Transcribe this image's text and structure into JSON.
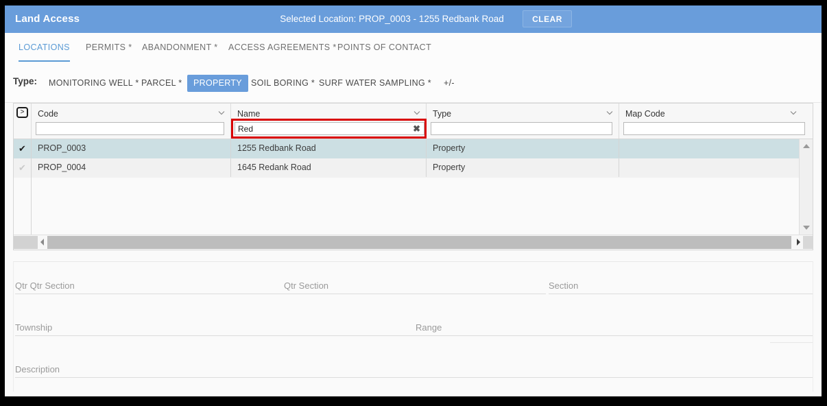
{
  "app": {
    "title": "Land Access",
    "selected_location": "Selected Location: PROP_0003 - 1255 Redbank Road",
    "clear_label": "CLEAR",
    "accent_color": "#699ddb",
    "active_tab_color": "#5b9bd5",
    "error_outline_color": "#d90000",
    "selected_row_color": "#ccdfe3"
  },
  "tabs": [
    {
      "label": "LOCATIONS",
      "active": true
    },
    {
      "label": "PERMITS *",
      "active": false
    },
    {
      "label": "ABANDONMENT *",
      "active": false
    },
    {
      "label": "ACCESS AGREEMENTS *",
      "active": false
    },
    {
      "label": "POINTS OF CONTACT",
      "active": false
    }
  ],
  "type_filter": {
    "label": "Type:",
    "options": [
      {
        "label": "MONITORING WELL *",
        "selected": false
      },
      {
        "label": "PARCEL *",
        "selected": false
      },
      {
        "label": "PROPERTY",
        "selected": true
      },
      {
        "label": "SOIL BORING *",
        "selected": false
      },
      {
        "label": "SURF WATER SAMPLING *",
        "selected": false
      },
      {
        "label": "+/-",
        "selected": false
      }
    ]
  },
  "grid": {
    "expand_toggle_glyph": ">",
    "columns": [
      {
        "title": "Code",
        "filter_value": "",
        "filter_placeholder": "",
        "caret": "chevron-down-icon"
      },
      {
        "title": "Name",
        "filter_value": "Red",
        "filter_placeholder": "",
        "caret": "chevron-down-icon",
        "highlighted": true,
        "clear_glyph": "✖"
      },
      {
        "title": "Type",
        "filter_value": "",
        "filter_placeholder": "",
        "caret": "chevron-down-icon"
      },
      {
        "title": "Map Code",
        "filter_value": "",
        "filter_placeholder": "",
        "caret": "chevron-down-icon"
      }
    ],
    "rows": [
      {
        "checked": true,
        "check_glyph": "✔",
        "code": "PROP_0003",
        "name": "1255 Redbank Road",
        "type": "Property",
        "map_code": ""
      },
      {
        "checked": false,
        "check_glyph": "✔",
        "code": "PROP_0004",
        "name": "1645 Redank Road",
        "type": "Property",
        "map_code": ""
      }
    ]
  },
  "form": {
    "fields": [
      {
        "label": "Qtr Qtr Section",
        "value": ""
      },
      {
        "label": "Qtr Section",
        "value": ""
      },
      {
        "label": "Section",
        "value": ""
      },
      {
        "label": "Township",
        "value": ""
      },
      {
        "label": "Range",
        "value": ""
      },
      {
        "label": "Description",
        "value": ""
      }
    ]
  }
}
